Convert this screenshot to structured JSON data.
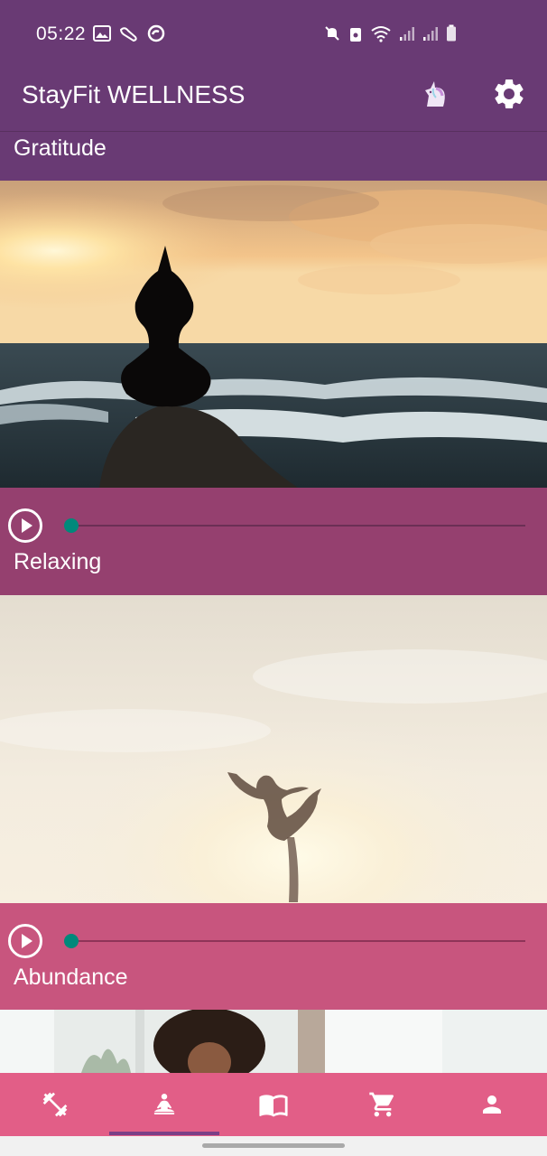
{
  "status_bar": {
    "time": "05:22",
    "left_icons": [
      "image-icon",
      "fitness-icon",
      "sync-icon"
    ],
    "right_icons": [
      "mute-icon",
      "lock-icon",
      "wifi-icon",
      "signal-icon",
      "signal-icon",
      "battery-icon"
    ]
  },
  "app_bar": {
    "title": "StayFit WELLNESS",
    "actions": [
      "unicorn-icon",
      "settings-gear-icon"
    ]
  },
  "sections": [
    {
      "label": "Gratitude",
      "player_progress": 0
    },
    {
      "label": "Relaxing",
      "player_progress": 0
    },
    {
      "label": "Abundance",
      "player_progress": 0
    }
  ],
  "bottom_nav": {
    "items": [
      {
        "icon": "dumbbell-icon"
      },
      {
        "icon": "meditation-icon",
        "selected": true
      },
      {
        "icon": "book-icon"
      },
      {
        "icon": "cart-icon"
      },
      {
        "icon": "person-icon"
      }
    ]
  },
  "colors": {
    "header": "#693a74",
    "player_1": "#95406f",
    "player_2": "#c8557e",
    "bottom_nav": "#e25e87",
    "slider_thumb": "#00897b",
    "nav_indicator": "#7b3f87"
  }
}
